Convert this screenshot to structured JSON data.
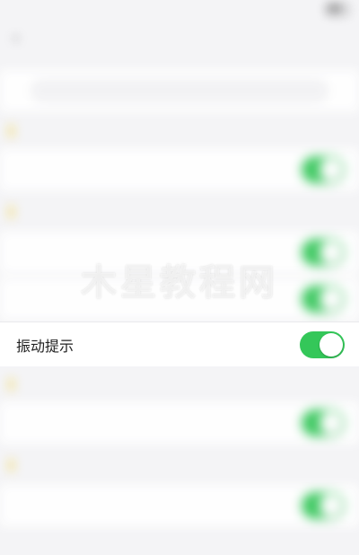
{
  "status_bar": {
    "carrier": "",
    "time": "",
    "battery": ""
  },
  "nav": {
    "title": "",
    "back_glyph": "‹"
  },
  "search_row": {
    "label": "",
    "value": ""
  },
  "sections": [
    {
      "header": "",
      "rows": [
        {
          "label": "",
          "on": true
        }
      ]
    },
    {
      "header": "",
      "rows": [
        {
          "label": "",
          "on": true
        },
        {
          "label": "",
          "on": true
        }
      ]
    },
    {
      "header": "",
      "rows": [
        {
          "label": "",
          "on": true
        }
      ]
    },
    {
      "header": "",
      "rows": [
        {
          "label": "",
          "on": true
        }
      ]
    }
  ],
  "focused_row": {
    "label": "振动提示",
    "on": true
  },
  "watermark": "木星教程网",
  "colors": {
    "toggle_on": "#34c759",
    "section_bullet": "#f3d76a",
    "background": "#f4f4f6"
  }
}
